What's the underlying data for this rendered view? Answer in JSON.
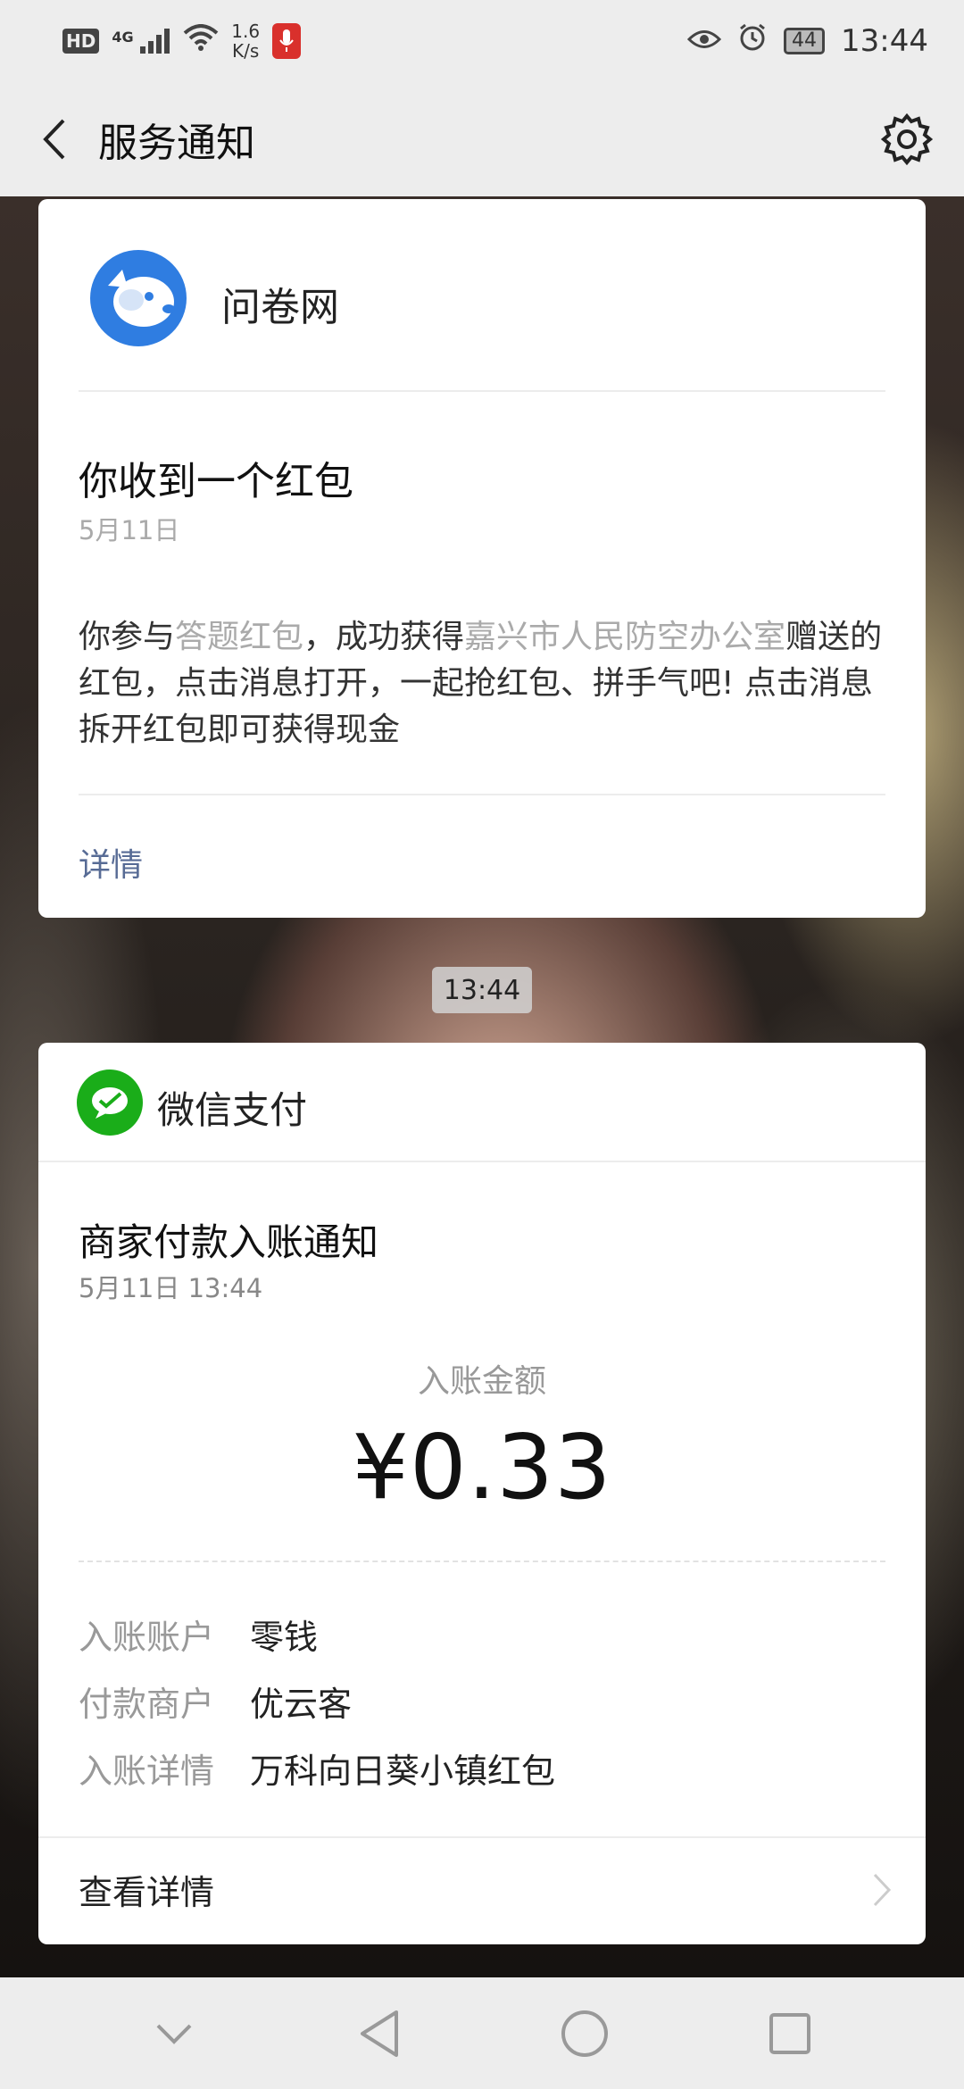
{
  "status_bar": {
    "hd": "HD",
    "signal": "4G",
    "speed_value": "1.6",
    "speed_unit": "K/s",
    "battery": "44",
    "time": "13:44"
  },
  "header": {
    "title": "服务通知"
  },
  "card1": {
    "sender": "问卷网",
    "title": "你收到一个红包",
    "date": "5月11日",
    "body_prefix": "你参与",
    "body_hl1": "答题红包",
    "body_mid": "，成功获得",
    "body_hl2": "嘉兴市人民防空办公室",
    "body_suffix": "赠送的红包，点击消息打开，一起抢红包、拼手气吧! 点击消息拆开红包即可获得现金",
    "link": "详情"
  },
  "timestamp": "13:44",
  "card2": {
    "sender": "微信支付",
    "title": "商家付款入账通知",
    "date": "5月11日  13:44",
    "amount_label": "入账金额",
    "amount": "¥0.33",
    "rows": [
      {
        "key": "入账账户",
        "value": "零钱"
      },
      {
        "key": "付款商户",
        "value": "优云客"
      },
      {
        "key": "入账详情",
        "value": "万科向日葵小镇红包"
      }
    ],
    "footer": "查看详情"
  },
  "colors": {
    "link": "#576b95",
    "wechat_pay_green": "#1aad19",
    "brand_blue": "#2f7de1",
    "mic_red": "#d9302c"
  }
}
